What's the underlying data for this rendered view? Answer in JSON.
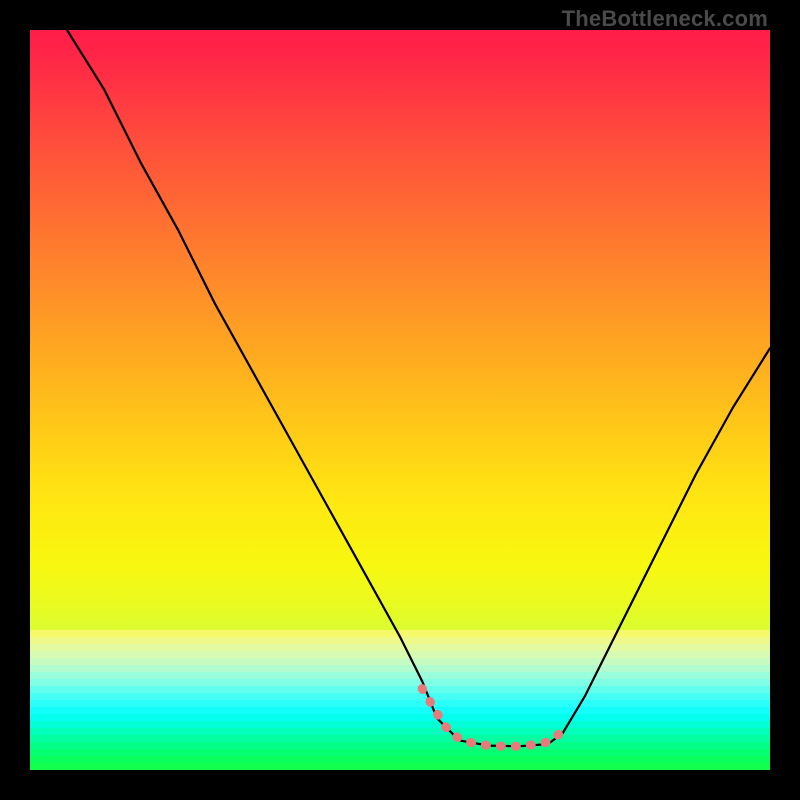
{
  "watermark": "TheBottleneck.com",
  "colors": {
    "background": "#000000",
    "curve": "#000000",
    "curve_width": 2.2,
    "marker": "#e77a7a",
    "marker_stroke_width": 9
  },
  "chart_data": {
    "type": "line",
    "title": "",
    "xlabel": "",
    "ylabel": "",
    "xlim": [
      0,
      100
    ],
    "ylim": [
      0,
      100
    ],
    "series": [
      {
        "name": "bottleneck-curve",
        "x": [
          5,
          10,
          15,
          20,
          25,
          30,
          35,
          40,
          45,
          50,
          53,
          55,
          58,
          62,
          66,
          70,
          72,
          75,
          80,
          85,
          90,
          95,
          100
        ],
        "values": [
          100,
          92,
          82,
          73,
          63,
          54,
          45,
          36,
          27,
          18,
          12,
          7,
          4,
          3.3,
          3.2,
          3.5,
          5,
          10,
          20,
          30,
          40,
          49,
          57
        ]
      }
    ],
    "highlight": {
      "x": [
        53,
        56,
        58,
        60,
        62,
        64,
        66,
        68,
        70,
        72
      ],
      "values": [
        11,
        6,
        4.2,
        3.6,
        3.3,
        3.2,
        3.2,
        3.4,
        3.8,
        5.2
      ]
    }
  }
}
